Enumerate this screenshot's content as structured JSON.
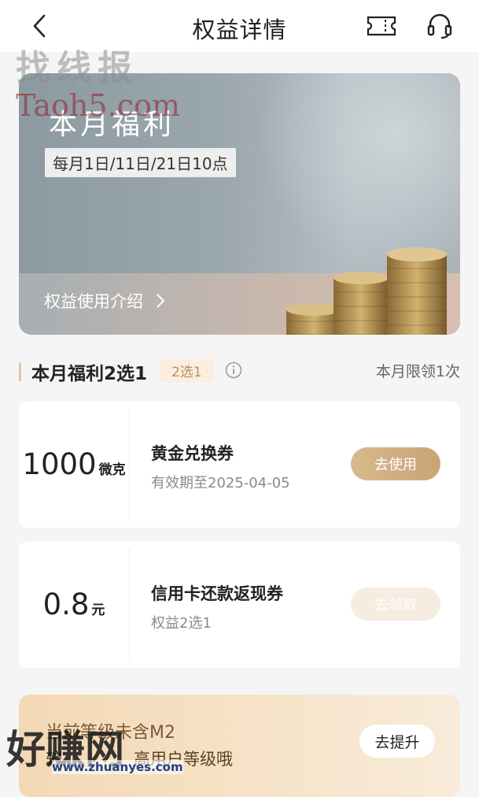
{
  "header": {
    "title": "权益详情",
    "icons": [
      "back-arrow-icon",
      "ticket-icon",
      "headset-icon"
    ]
  },
  "banner": {
    "title": "本月福利",
    "date_badge": "每月1日/11日/21日10点",
    "link_label": "权益使用介绍"
  },
  "section": {
    "title": "本月福利2选1",
    "tag": "2选1",
    "right_text": "本月限领1次"
  },
  "benefits": [
    {
      "amount": "1000",
      "unit": "微克",
      "title": "黄金兑换券",
      "subtitle": "有效期至2025-04-05",
      "button": "去使用",
      "button_state": "active"
    },
    {
      "amount": "0.8",
      "unit": "元",
      "title": "信用卡还款返现券",
      "subtitle": "权益2选1",
      "button": "去领取",
      "button_state": "disabled"
    }
  ],
  "upgrade": {
    "line1": "当前等级未含M2",
    "line2": "较…",
    "line2_tail": "高用户等级哦",
    "button": "去提升"
  },
  "watermarks": {
    "top_cn": "找线报",
    "top_en": "Taoh5.com",
    "bottom_cn": "好赚网",
    "bottom_url": "www.zhuanyes.com"
  },
  "colors": {
    "accent_gold": "#c9a375",
    "tag_bg": "#fbeee0",
    "page_bg": "#f5f5f5"
  }
}
